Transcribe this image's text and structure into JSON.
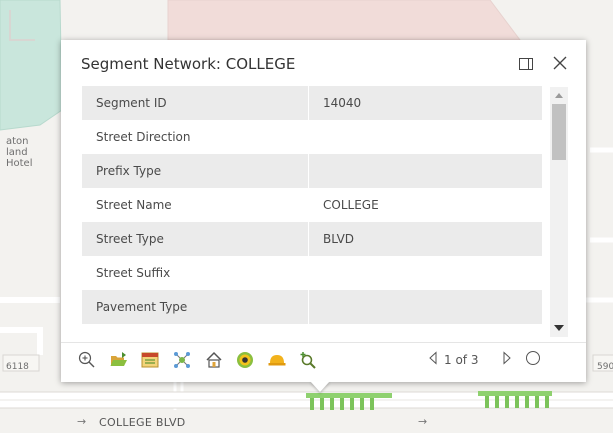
{
  "popup": {
    "title": "Segment Network: COLLEGE",
    "dock_icon": "dock-icon",
    "close_icon": "close-icon",
    "attributes": [
      {
        "name": "Segment ID",
        "value": "14040"
      },
      {
        "name": "Street Direction",
        "value": ""
      },
      {
        "name": "Prefix Type",
        "value": ""
      },
      {
        "name": "Street Name",
        "value": "COLLEGE"
      },
      {
        "name": "Street Type",
        "value": "BLVD"
      },
      {
        "name": "Street Suffix",
        "value": ""
      },
      {
        "name": "Pavement Type",
        "value": ""
      }
    ],
    "toolbar": [
      {
        "icon": "zoom-to-icon"
      },
      {
        "icon": "open-folder-icon"
      },
      {
        "icon": "table-card-icon"
      },
      {
        "icon": "network-nodes-icon"
      },
      {
        "icon": "house-icon"
      },
      {
        "icon": "bullseye-icon"
      },
      {
        "icon": "hardhat-icon"
      },
      {
        "icon": "search-zoom-icon"
      }
    ],
    "pager": {
      "text": "1 of 3",
      "current": 1,
      "total": 3
    }
  },
  "map": {
    "hotel_label": [
      "aton",
      "land",
      "Hotel"
    ],
    "address_left": "6118",
    "address_right": "590",
    "street_label": "COLLEGE BLVD",
    "arrow": "→"
  }
}
